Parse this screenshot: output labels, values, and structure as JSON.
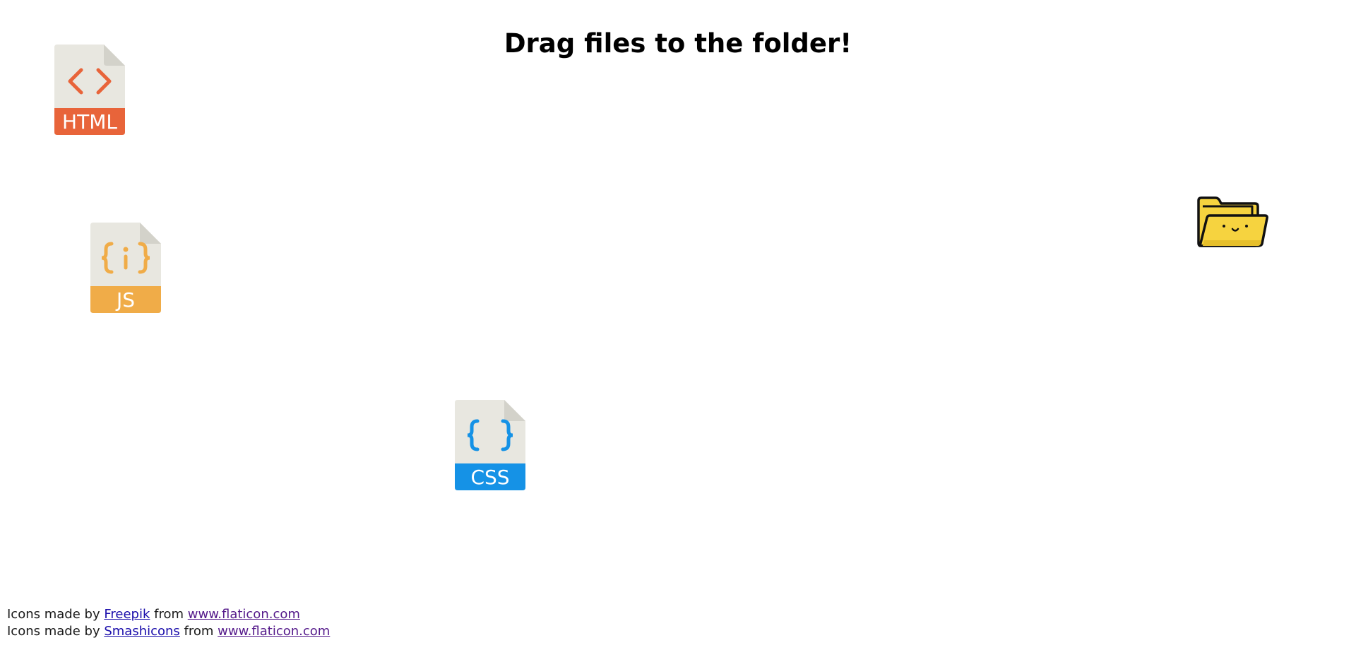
{
  "page": {
    "title": "Drag files to the folder!"
  },
  "files": {
    "html": {
      "label": "HTML",
      "symbol": "< >",
      "color": "#e8643a"
    },
    "js": {
      "label": "JS",
      "symbol": "{ i }",
      "color": "#f0ac48"
    },
    "css": {
      "label": "CSS",
      "symbol": "{ }",
      "color": "#1592e6"
    }
  },
  "folder": {
    "color": "#f6d33f"
  },
  "credits": {
    "line1": {
      "prefix": "Icons made by",
      "author": "Freepik",
      "middle": "from",
      "site": "www.flaticon.com"
    },
    "line2": {
      "prefix": "Icons made by",
      "author": "Smashicons",
      "middle": "from",
      "site": "www.flaticon.com"
    }
  }
}
